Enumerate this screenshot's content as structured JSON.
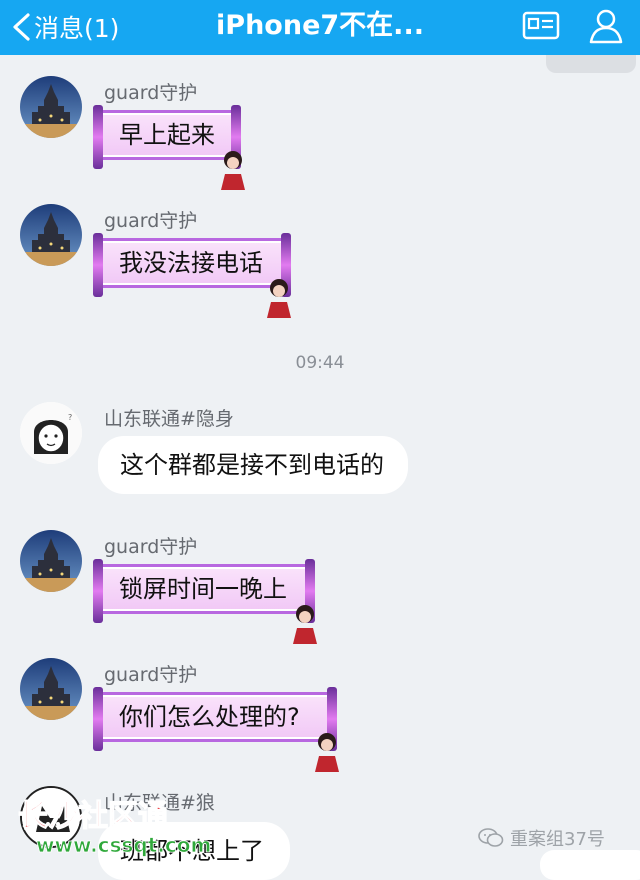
{
  "header": {
    "back_label": "消息(1)",
    "title": "iPhone7不在...",
    "background": "#16a7f2"
  },
  "messages": [
    {
      "sender": "guard守护",
      "text": "早上起来",
      "style": "fancy"
    },
    {
      "sender": "guard守护",
      "text": "我没法接电话",
      "style": "fancy"
    },
    {
      "sender": "山东联通#隐身",
      "text": "这个群都是接不到电话的",
      "style": "plain"
    },
    {
      "sender": "guard守护",
      "text": "锁屏时间一晚上",
      "style": "fancy"
    },
    {
      "sender": "guard守护",
      "text": "你们怎么处理的?",
      "style": "fancy"
    },
    {
      "sender": "山东联通#狼",
      "text": "班都不想上了",
      "style": "plain"
    }
  ],
  "timestamp": "09:44",
  "watermarks": {
    "left_title": "长沙社区通",
    "left_url": "www.cssqt.com",
    "right_text": "重案组37号"
  },
  "icons": {
    "back": "chevron-left-icon",
    "card": "profile-card-icon",
    "members": "group-members-icon",
    "watermark": "wechat-icon"
  }
}
